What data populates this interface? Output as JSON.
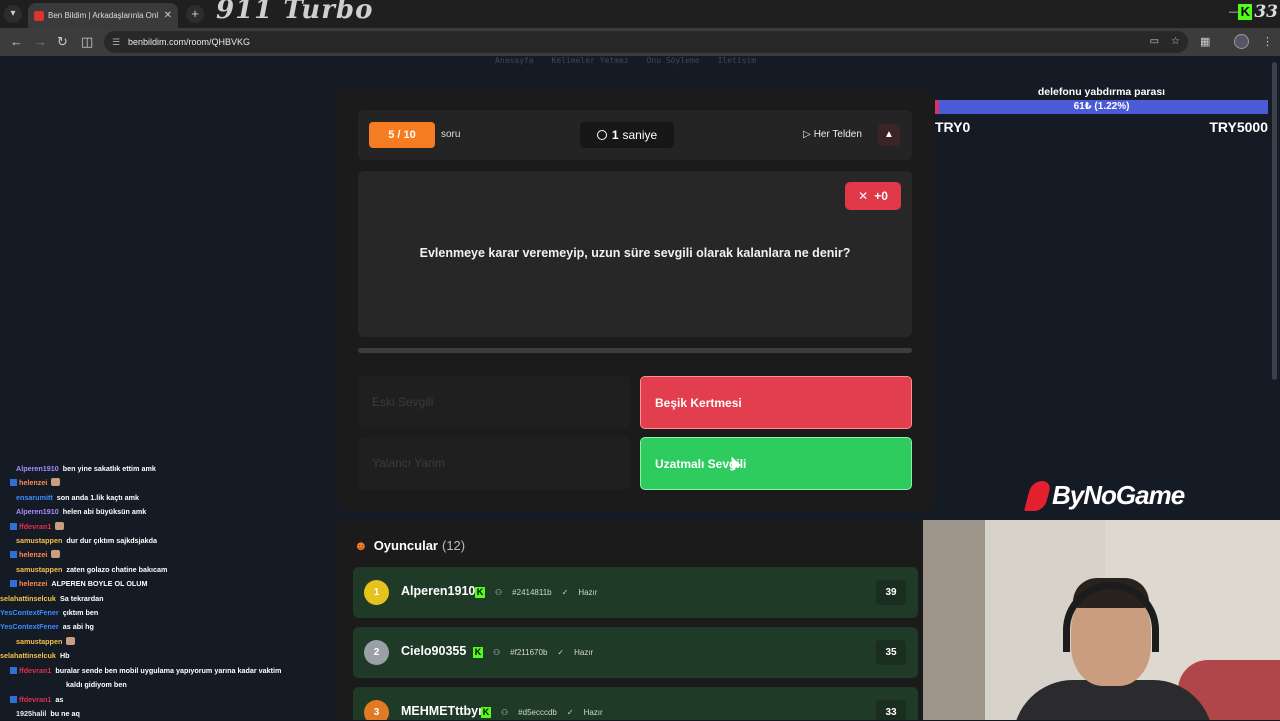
{
  "browser": {
    "tab_title": "Ben Bildim | Arkadaşlarınla Onl",
    "overlay_title": "911 Turbo",
    "url": "benbildim.com/room/QHBVKG",
    "kick_count": "33"
  },
  "site_nav": [
    "Anasayfa",
    "Kelimeler Yetmez",
    "Onu Söyleme",
    "İletişim"
  ],
  "game": {
    "question_counter": "5 / 10",
    "question_word": "soru",
    "timer_value": "1",
    "timer_unit": "saniye",
    "category": "Her Telden",
    "score_delta": "+0",
    "question": "Evlenmeye karar veremeyip, uzun süre sevgili olarak kalanlara ne denir?",
    "answers": [
      {
        "label": "Eski Sevgili",
        "state": "dim"
      },
      {
        "label": "Beşik Kertmesi",
        "state": "wrong"
      },
      {
        "label": "Yalancı Yarim",
        "state": "dim"
      },
      {
        "label": "Uzatmalı Sevgili",
        "state": "correct"
      }
    ]
  },
  "players": {
    "title": "Oyuncular",
    "count": "(12)",
    "list": [
      {
        "rank": "1",
        "name": "Alperen1910",
        "id": "#2414811b",
        "status": "Hazır",
        "score": "39",
        "rank_color": "#e6c21f"
      },
      {
        "rank": "2",
        "name": "Cielo90355",
        "id": "#f211670b",
        "status": "Hazır",
        "score": "35",
        "rank_color": "#9aa0a6"
      },
      {
        "rank": "3",
        "name": "MEHMETttbyr",
        "id": "#d5ecccdb",
        "status": "Hazır",
        "score": "33",
        "rank_color": "#e07b24"
      }
    ]
  },
  "donation": {
    "title": "delefonu yabdırma parası",
    "progress_text": "61₺ (1.22%)",
    "progress_fraction": 0.0122,
    "min_label": "TRY0",
    "max_label": "TRY5000"
  },
  "sponsor": "ByNoGame",
  "chat": [
    {
      "user": "Alperen1910",
      "color": "#a98bff",
      "text": "ben yine sakatlık ettim amk",
      "badge": false,
      "emote": false
    },
    {
      "user": "helenzei",
      "color": "#ff8a4c",
      "text": "",
      "badge": true,
      "emote": true
    },
    {
      "user": "ensarumitt",
      "color": "#3c8cff",
      "text": "son anda 1.lik kaçtı amk",
      "badge": false,
      "emote": false
    },
    {
      "user": "Alperen1910",
      "color": "#a98bff",
      "text": "helen abi büyüksün amk",
      "badge": false,
      "emote": false
    },
    {
      "user": "ffdevran1",
      "color": "#e0304a",
      "text": "",
      "badge": true,
      "emote": true
    },
    {
      "user": "samustappen",
      "color": "#f5c04a",
      "text": "dur dur çıktım sajkdsjakda",
      "badge": false,
      "emote": false
    },
    {
      "user": "helenzei",
      "color": "#ff8a4c",
      "text": "",
      "badge": true,
      "emote": true
    },
    {
      "user": "samustappen",
      "color": "#f5c04a",
      "text": "zaten golazo chatine bakıcam",
      "badge": false,
      "emote": false
    },
    {
      "user": "helenzei",
      "color": "#ff8a4c",
      "text": "ALPEREN BOYLE OL OLUM",
      "badge": true,
      "emote": false
    },
    {
      "user": "selahattinselcuk",
      "color": "#f5c04a",
      "text": "Sa tekrardan",
      "badge": false,
      "emote": false
    },
    {
      "user": "YesContextFener",
      "color": "#3c8cff",
      "text": "çıktım ben",
      "badge": false,
      "emote": false
    },
    {
      "user": "YesContextFener",
      "color": "#3c8cff",
      "text": "as abi hg",
      "badge": false,
      "emote": false
    },
    {
      "user": "samustappen",
      "color": "#f5c04a",
      "text": "",
      "badge": false,
      "emote": true
    },
    {
      "user": "selahattinselcuk",
      "color": "#f5c04a",
      "text": "Hb",
      "badge": false,
      "emote": false
    },
    {
      "user": "ffdevran1",
      "color": "#e0304a",
      "text": "buralar sende ben mobil uygulama yapıyorum yarına kadar vaktim",
      "badge": true,
      "emote": false
    },
    {
      "user": "",
      "color": "#e0304a",
      "text": "kaldı gidiyom ben",
      "badge": false,
      "emote": false
    },
    {
      "user": "ffdevran1",
      "color": "#e0304a",
      "text": "as",
      "badge": true,
      "emote": false
    },
    {
      "user": "1925halil",
      "color": "#e8e8e8",
      "text": "bu ne aq",
      "badge": false,
      "emote": false
    }
  ]
}
